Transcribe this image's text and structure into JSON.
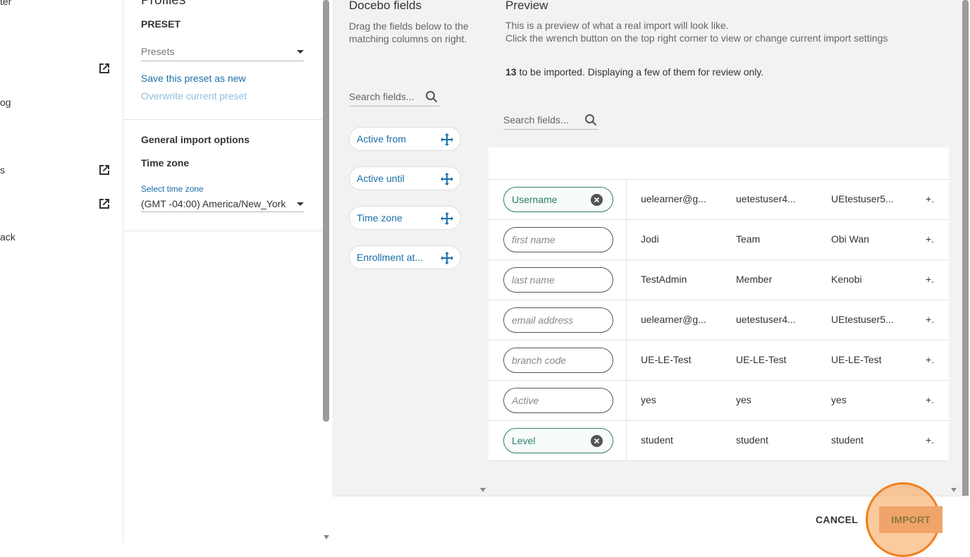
{
  "leftnav": {
    "items": [
      {
        "text": "ter"
      },
      {
        "text": "og"
      },
      {
        "text": "s"
      },
      {
        "text": "ack"
      }
    ]
  },
  "settings": {
    "title": "Profiles",
    "preset_label": "PRESET",
    "presets_placeholder": "Presets",
    "save_link": "Save this preset as new",
    "overwrite_link": "Overwrite current preset",
    "general_label": "General import options",
    "timezone_label": "Time zone",
    "timezone_small": "Select time zone",
    "timezone_value": "(GMT -04:00) America/New_York"
  },
  "fields": {
    "heading": "Docebo fields",
    "description": "Drag the fields below to the matching columns on right.",
    "search_placeholder": "Search fields...",
    "chips": [
      {
        "label": "Active from"
      },
      {
        "label": "Active until"
      },
      {
        "label": "Time zone"
      },
      {
        "label": "Enrollment at..."
      }
    ]
  },
  "preview": {
    "heading": "Preview",
    "desc1": "This is a preview of what a real import will look like.",
    "desc2": "Click the wrench button on the top right corner to view or change current import settings",
    "count": "13",
    "count_text": " to be imported. Displaying a few of them for review only.",
    "search_placeholder": "Search fields...",
    "rows": [
      {
        "field": "Username",
        "mapped": true,
        "values": [
          "uelearner@g...",
          "uetestuser4...",
          "UEtestuser5...",
          "+."
        ]
      },
      {
        "field": "first name",
        "mapped": false,
        "values": [
          "Jodi",
          "Team",
          "Obi Wan",
          "+."
        ]
      },
      {
        "field": "last name",
        "mapped": false,
        "values": [
          "TestAdmin",
          "Member",
          "Kenobi",
          "+."
        ]
      },
      {
        "field": "email address",
        "mapped": false,
        "values": [
          "uelearner@g...",
          "uetestuser4...",
          "UEtestuser5...",
          "+."
        ]
      },
      {
        "field": "branch code",
        "mapped": false,
        "values": [
          "UE-LE-Test",
          "UE-LE-Test",
          "UE-LE-Test",
          "+."
        ]
      },
      {
        "field": "Active",
        "mapped": false,
        "values": [
          "yes",
          "yes",
          "yes",
          "+."
        ]
      },
      {
        "field": "Level",
        "mapped": true,
        "values": [
          "student",
          "student",
          "student",
          "+."
        ]
      }
    ]
  },
  "footer": {
    "cancel": "CANCEL",
    "import": "IMPORT"
  },
  "colors": {
    "link": "#1a6fa8",
    "mapped": "#2e7d6f",
    "highlight": "#f07f1d"
  }
}
